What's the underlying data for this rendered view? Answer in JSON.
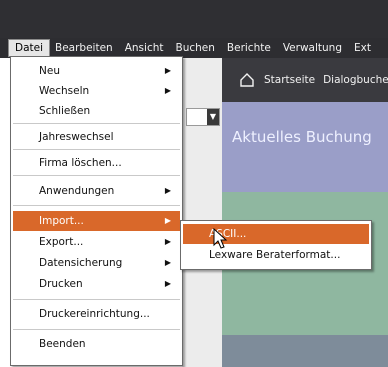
{
  "menubar": {
    "items": [
      {
        "label": "Datei"
      },
      {
        "label": "Bearbeiten"
      },
      {
        "label": "Ansicht"
      },
      {
        "label": "Buchen"
      },
      {
        "label": "Berichte"
      },
      {
        "label": "Verwaltung"
      },
      {
        "label": "Ext"
      }
    ]
  },
  "navbar": {
    "home_label": "Startseite",
    "dialog_label": "Dialogbuche"
  },
  "content": {
    "title": "Aktuelles Buchung"
  },
  "file_menu": {
    "items": {
      "neu": "Neu",
      "wechseln": "Wechseln",
      "schliessen": "Schließen",
      "jahreswechsel": "Jahreswechsel",
      "firma_loeschen": "Firma löschen...",
      "anwendungen": "Anwendungen",
      "import": "Import...",
      "export": "Export...",
      "datensicherung": "Datensicherung",
      "drucken": "Drucken",
      "druckereinrichtung": "Druckereinrichtung...",
      "beenden": "Beenden"
    }
  },
  "import_submenu": {
    "items": {
      "ascii": "ASCII...",
      "lexware": "Lexware Beraterformat..."
    }
  },
  "colors": {
    "highlight": "#d9682a",
    "menubar_bg": "#2d2d31",
    "header_bg": "#9a9ec8",
    "body_bg": "#8fb7a0"
  }
}
